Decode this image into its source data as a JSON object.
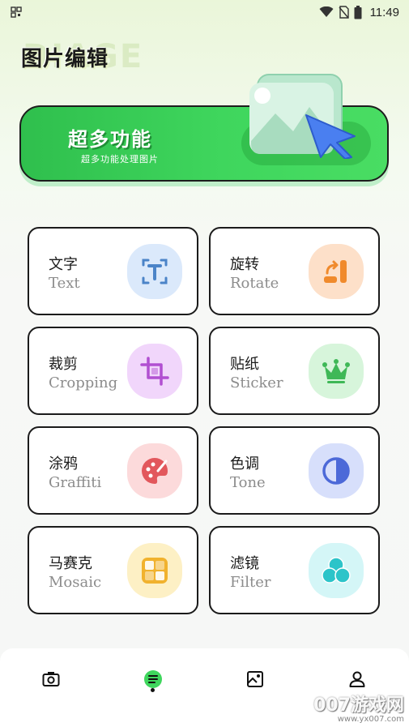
{
  "status": {
    "time": "11:49"
  },
  "header": {
    "title": "图片编辑",
    "watermark": "DIAGE"
  },
  "banner": {
    "title": "超多功能",
    "subtitle": "超多功能处理图片"
  },
  "tools": [
    {
      "zh": "文字",
      "en": "Text",
      "icon": "text-frame-icon",
      "bg": "#dbe9fb",
      "color": "#4b84c8"
    },
    {
      "zh": "旋转",
      "en": "Rotate",
      "icon": "rotate-icon",
      "bg": "#fde0c9",
      "color": "#f08a2c"
    },
    {
      "zh": "裁剪",
      "en": "Cropping",
      "icon": "crop-icon",
      "bg": "#f1d6fb",
      "color": "#b14fd1"
    },
    {
      "zh": "贴纸",
      "en": "Sticker",
      "icon": "crown-icon",
      "bg": "#d7f5db",
      "color": "#3fb857"
    },
    {
      "zh": "涂鸦",
      "en": "Graffiti",
      "icon": "palette-icon",
      "bg": "#fcdadb",
      "color": "#e2575c"
    },
    {
      "zh": "色调",
      "en": "Tone",
      "icon": "contrast-icon",
      "bg": "#d7dffb",
      "color": "#4c69d8"
    },
    {
      "zh": "马赛克",
      "en": "Mosaic",
      "icon": "mosaic-icon",
      "bg": "#fdf0c5",
      "color": "#f1b22e"
    },
    {
      "zh": "滤镜",
      "en": "Filter",
      "icon": "filter-circles-icon",
      "bg": "#d4f6f7",
      "color": "#2cc4c9"
    }
  ],
  "nav": {
    "items": [
      {
        "name": "camera-icon",
        "active": false
      },
      {
        "name": "menu-list-icon",
        "active": true
      },
      {
        "name": "image-icon",
        "active": false
      },
      {
        "name": "profile-icon",
        "active": false
      }
    ]
  },
  "watermark": {
    "main": "007游戏网",
    "url": "www.yx007.com"
  },
  "colors": {
    "accent": "#3fd65d",
    "border": "#1b1b1b"
  }
}
